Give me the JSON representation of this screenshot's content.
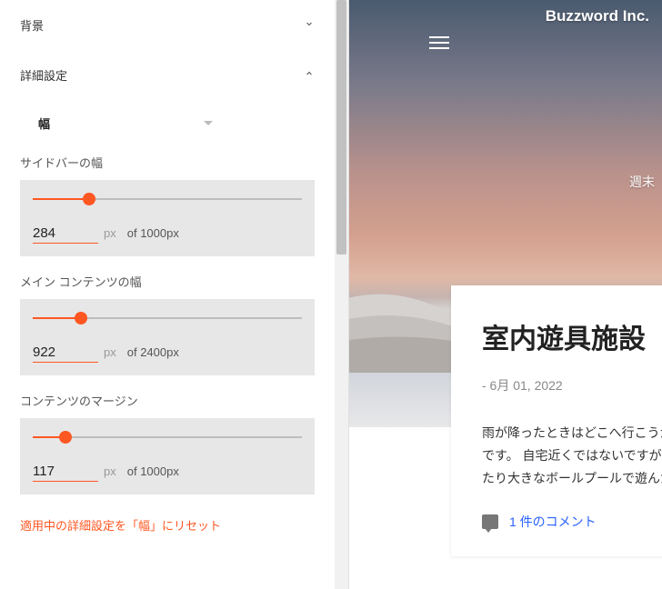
{
  "panel": {
    "background_section": "背景",
    "advanced_section": "詳細設定",
    "dropdown_width": "幅",
    "fields": {
      "sidebar_width": {
        "label": "サイドバーの幅",
        "value": "284",
        "unit": "px",
        "of": "of 1000px",
        "max": 1000
      },
      "main_width": {
        "label": "メイン コンテンツの幅",
        "value": "922",
        "unit": "px",
        "of": "of 2400px",
        "max": 2400
      },
      "margin": {
        "label": "コンテンツのマージン",
        "value": "117",
        "unit": "px",
        "of": "of 1000px",
        "max": 1000
      }
    },
    "reset": "適用中の詳細設定を「幅」にリセット"
  },
  "preview": {
    "site_title": "Buzzword Inc.",
    "side_label": "週末",
    "post_title": "室内遊具施設",
    "post_date": "- 6月 01, 2022",
    "post_body": "雨が降ったときはどこへ行こうか\nです。 自宅近くではないですが、\nたり大きなボールプールで遊んだ",
    "comments": "1 件のコメント"
  }
}
